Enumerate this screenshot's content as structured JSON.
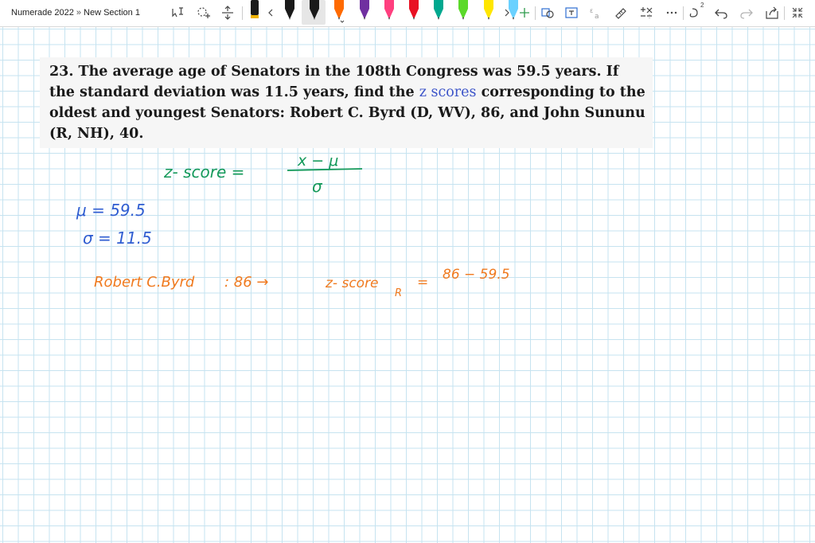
{
  "breadcrumb": {
    "notebook": "Numerade 2022",
    "separator": "»",
    "section": "New Section 1"
  },
  "toolbar": {
    "tools": [
      {
        "name": "lasso-select-icon"
      },
      {
        "name": "eraser-icon"
      },
      {
        "name": "insert-space-icon"
      }
    ],
    "pens": [
      {
        "color": "#1a1a1a"
      },
      {
        "color": "#1a1a1a"
      },
      {
        "color": "#ff6a00",
        "active": true
      },
      {
        "color": "#7030a0"
      },
      {
        "color": "#ff3f7f"
      },
      {
        "color": "#e81123"
      },
      {
        "color": "#00a88f"
      },
      {
        "color": "#5bd92a"
      },
      {
        "color": "#ffe600"
      },
      {
        "color": "#6ad1ff"
      }
    ],
    "redo_superscript": "2"
  },
  "problem": {
    "number": "23.",
    "text_before": "The average age of Senators in the 108th Congress was 59.5 years. If the standard deviation was 11.5 years, find the",
    "highlight": "z scores",
    "text_after": "corresponding to the oldest and youngest Senators: Robert C. Byrd (D, WV), 86, and John Sununu (R, NH), 40."
  },
  "handwriting": {
    "formula_label": "z- score =",
    "numerator": "x − μ",
    "denominator": "σ",
    "mu_line": "μ = 59.5",
    "sigma_line": "σ = 11.5",
    "byrd_name": "Robert C.Byrd",
    "byrd_value": ": 86 →",
    "byrd_z": "z- score",
    "byrd_sub": "R",
    "byrd_rel": "=",
    "byrd_partial": "86 − 59.5",
    "colors": {
      "green": "#14995a",
      "blue": "#2f5dd1",
      "orange": "#f07a1f"
    }
  }
}
